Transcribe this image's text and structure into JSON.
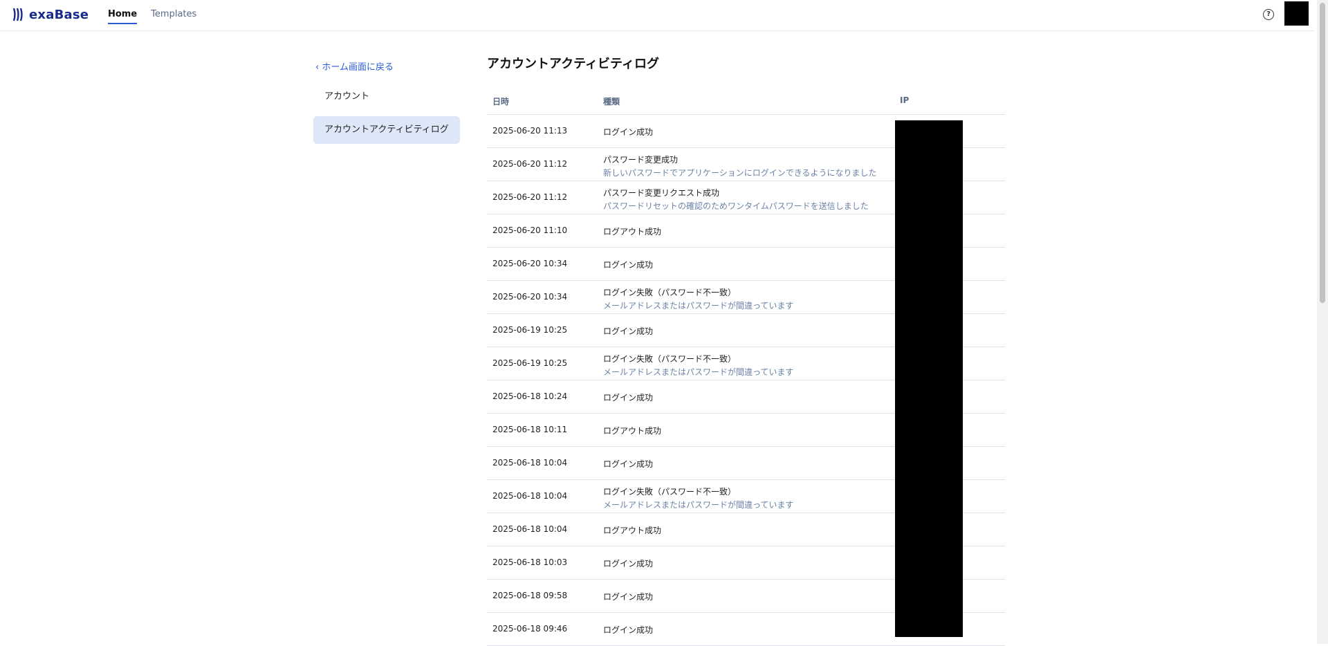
{
  "header": {
    "logo_text": "exaBase",
    "tabs": [
      {
        "label": "Home",
        "active": true
      },
      {
        "label": "Templates",
        "active": false
      }
    ],
    "help_icon": "question-circle-icon",
    "help_glyph": "?"
  },
  "sidebar": {
    "back_label": "‹ ホーム画面に戻る",
    "items": [
      {
        "label": "アカウント",
        "active": false
      },
      {
        "label": "アカウントアクティビティログ",
        "active": true
      }
    ]
  },
  "main": {
    "title": "アカウントアクティビティログ",
    "columns": {
      "date": "日時",
      "type": "種類",
      "ip": "IP"
    },
    "rows": [
      {
        "date": "2025-06-20 11:13",
        "type": "ログイン成功",
        "desc": ""
      },
      {
        "date": "2025-06-20 11:12",
        "type": "パスワード変更成功",
        "desc": "新しいパスワードでアプリケーションにログインできるようになりました"
      },
      {
        "date": "2025-06-20 11:12",
        "type": "パスワード変更リクエスト成功",
        "desc": "パスワードリセットの確認のためワンタイムパスワードを送信しました"
      },
      {
        "date": "2025-06-20 11:10",
        "type": "ログアウト成功",
        "desc": ""
      },
      {
        "date": "2025-06-20 10:34",
        "type": "ログイン成功",
        "desc": ""
      },
      {
        "date": "2025-06-20 10:34",
        "type": "ログイン失敗（パスワード不一致）",
        "desc": "メールアドレスまたはパスワードが間違っています"
      },
      {
        "date": "2025-06-19 10:25",
        "type": "ログイン成功",
        "desc": ""
      },
      {
        "date": "2025-06-19 10:25",
        "type": "ログイン失敗（パスワード不一致）",
        "desc": "メールアドレスまたはパスワードが間違っています"
      },
      {
        "date": "2025-06-18 10:24",
        "type": "ログイン成功",
        "desc": ""
      },
      {
        "date": "2025-06-18 10:11",
        "type": "ログアウト成功",
        "desc": ""
      },
      {
        "date": "2025-06-18 10:04",
        "type": "ログイン成功",
        "desc": ""
      },
      {
        "date": "2025-06-18 10:04",
        "type": "ログイン失敗（パスワード不一致）",
        "desc": "メールアドレスまたはパスワードが間違っています"
      },
      {
        "date": "2025-06-18 10:04",
        "type": "ログアウト成功",
        "desc": ""
      },
      {
        "date": "2025-06-18 10:03",
        "type": "ログイン成功",
        "desc": ""
      },
      {
        "date": "2025-06-18 09:58",
        "type": "ログイン成功",
        "desc": ""
      },
      {
        "date": "2025-06-18 09:46",
        "type": "ログイン成功",
        "desc": ""
      }
    ]
  },
  "colors": {
    "accent": "#2a5bd7",
    "logo": "#1a2a8c",
    "sidebar_active_bg": "#dde7f8",
    "desc_text": "#6b82a6"
  }
}
